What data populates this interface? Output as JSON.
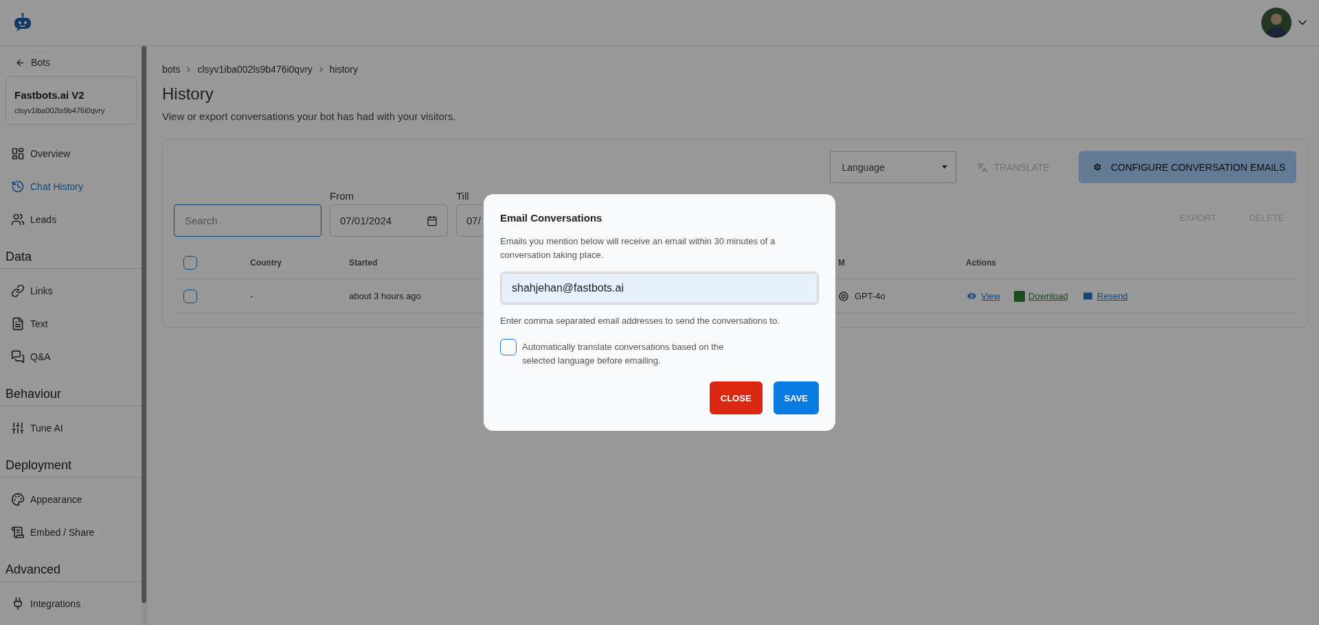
{
  "sidebar": {
    "back_link": "Bots",
    "bot": {
      "name": "Fastbots.ai V2",
      "id": "clsyv1iba002ls9b476i0qvry"
    },
    "groups": [
      {
        "items": [
          {
            "label": "Overview",
            "selected": false
          },
          {
            "label": "Chat History",
            "selected": true
          },
          {
            "label": "Leads",
            "selected": false
          }
        ]
      },
      {
        "heading": "Data",
        "items": [
          {
            "label": "Links",
            "selected": false
          },
          {
            "label": "Text",
            "selected": false
          },
          {
            "label": "Q&A",
            "selected": false
          }
        ]
      },
      {
        "heading": "Behaviour",
        "items": [
          {
            "label": "Tune AI",
            "selected": false
          }
        ]
      },
      {
        "heading": "Deployment",
        "items": [
          {
            "label": "Appearance",
            "selected": false
          },
          {
            "label": "Embed / Share",
            "selected": false
          }
        ]
      },
      {
        "heading": "Advanced",
        "items": [
          {
            "label": "Integrations",
            "selected": false
          }
        ]
      }
    ]
  },
  "breadcrumb": [
    "bots",
    "clsyv1iba002ls9b476i0qvry",
    "history"
  ],
  "page_title": "History",
  "page_description": "View or export conversations your bot has had with your visitors.",
  "language_select": {
    "value": "Language"
  },
  "translate_button": {
    "label": "TRANSLATE",
    "disabled": true
  },
  "configure_button": {
    "label": "CONFIGURE CONVERSATION EMAILS"
  },
  "search": {
    "placeholder": "Search"
  },
  "from": {
    "label": "From",
    "value": "07/01/2024"
  },
  "till": {
    "label": "Till",
    "value": "07/"
  },
  "export_button": {
    "label": "EXPORT",
    "disabled": true
  },
  "delete_button": {
    "label": "DELETE",
    "disabled": true
  },
  "table": {
    "select_all": {
      "checked": false
    },
    "columns": [
      "Country",
      "Started",
      "M",
      "Actions"
    ],
    "rows": [
      {
        "checked": false,
        "country": "-",
        "started": "about 3 hours ago",
        "column_4": "GPT-4o",
        "actions": [
          {
            "kind": "view",
            "label": "View"
          },
          {
            "kind": "download",
            "label": "Download"
          },
          {
            "kind": "resend",
            "label": "Resend"
          }
        ]
      }
    ]
  },
  "modal": {
    "title": "Email Conversations",
    "description": "Emails you mention below will receive an email within 30 minutes of a conversation taking place.",
    "email_value": "shahjehan@fastbots.ai",
    "helper": "Enter comma separated email addresses to send the conversations to.",
    "auto_translate": {
      "label": "Automatically translate conversations based on the selected language before emailing.",
      "checked": false
    },
    "buttons": [
      {
        "kind": "danger",
        "label": "CLOSE"
      },
      {
        "kind": "primary",
        "label": "SAVE"
      }
    ]
  }
}
